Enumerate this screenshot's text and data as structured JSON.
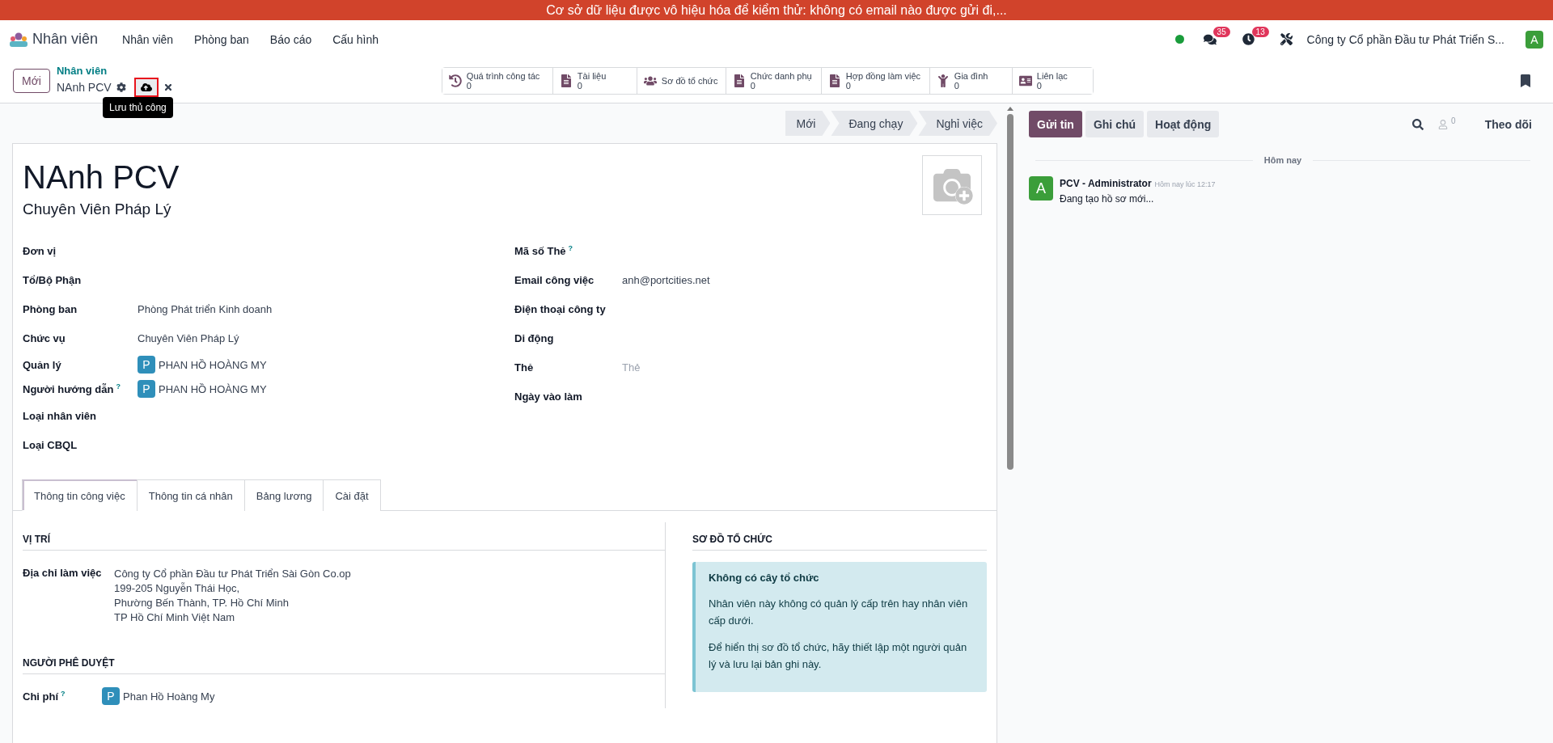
{
  "banner": {
    "text": "Cơ sở dữ liệu được vô hiệu hóa để kiểm thử: không có email nào được gửi đi,..."
  },
  "navbar": {
    "app_name": "Nhân viên",
    "menu": [
      "Nhân viên",
      "Phòng ban",
      "Báo cáo",
      "Cấu hình"
    ],
    "messages_badge": "35",
    "activities_badge": "13",
    "company": "Công ty Cổ phần Đầu tư Phát Triển S...",
    "avatar": "A"
  },
  "control_panel": {
    "new_button": "Mới",
    "breadcrumb": "Nhân viên",
    "record_name": "NAnh PCV",
    "tooltip": "Lưu thủ công",
    "smart_buttons": [
      {
        "label": "Quá trình công tác",
        "count": "0"
      },
      {
        "label": "Tài liệu",
        "count": "0"
      },
      {
        "label": "Sơ đồ tổ chức"
      },
      {
        "label": "Chức danh phụ",
        "count": "0"
      },
      {
        "label": "Hợp đồng làm việc",
        "count": "0"
      },
      {
        "label": "Gia đình",
        "count": "0"
      },
      {
        "label": "Liên lạc",
        "count": "0"
      }
    ]
  },
  "statusbar": [
    {
      "label": "Mới",
      "selected": false
    },
    {
      "label": "Đang chạy",
      "selected": false
    },
    {
      "label": "Nghỉ việc",
      "selected": false
    }
  ],
  "form": {
    "name": "NAnh PCV",
    "job_title": "Chuyên Viên Pháp Lý",
    "left_fields": [
      {
        "label": "Đơn vị",
        "kind": "text"
      },
      {
        "label": "Tổ/Bộ Phận",
        "kind": "text"
      },
      {
        "label": "Phòng ban",
        "kind": "text",
        "value": "Phòng Phát triển Kinh doanh"
      },
      {
        "label": "Chức vụ",
        "kind": "text",
        "value": "Chuyên Viên Pháp Lý"
      },
      {
        "label": "Quản lý",
        "kind": "person",
        "avatar": "P",
        "value": "PHAN HỒ HOÀNG MY"
      },
      {
        "label": "Người hướng dẫn",
        "help": "?",
        "kind": "person",
        "avatar": "P",
        "value": "PHAN HỒ HOÀNG MY"
      },
      {
        "label": "Loại nhân viên",
        "kind": "text"
      },
      {
        "label": "Loại CBQL",
        "kind": "text"
      }
    ],
    "right_fields": [
      {
        "label": "Mã số Thẻ",
        "help": "?",
        "kind": "text"
      },
      {
        "label": "Email công việc",
        "kind": "text",
        "value": "anh@portcities.net"
      },
      {
        "label": "Điện thoại công ty",
        "kind": "text"
      },
      {
        "label": "Di động",
        "kind": "text"
      },
      {
        "label": "Thẻ",
        "kind": "text",
        "placeholder": "Thẻ"
      },
      {
        "label": "Ngày vào làm",
        "kind": "text"
      }
    ]
  },
  "tabs": [
    {
      "label": "Thông tin công việc",
      "selected": true
    },
    {
      "label": "Thông tin cá nhân",
      "selected": false
    },
    {
      "label": "Bảng lương",
      "selected": false
    },
    {
      "label": "Cài đặt",
      "selected": false
    }
  ],
  "position": {
    "title": "VỊ TRÍ",
    "label": "Địa chỉ làm việc",
    "lines": [
      "Công ty Cổ phần Đầu tư Phát Triển Sài Gòn Co.op",
      "199-205 Nguyễn Thái Học,",
      "Phường Bến Thành, TP. Hồ Chí Minh",
      "TP Hồ Chí Minh Việt Nam"
    ]
  },
  "approvers": {
    "title": "NGƯỜI PHÊ DUYỆT",
    "fields": [
      {
        "label": "Chi phí",
        "help": "?",
        "avatar": "P",
        "value": "Phan Hồ Hoàng My"
      }
    ]
  },
  "org_chart": {
    "title": "SƠ ĐỒ TỔ CHỨC",
    "alert_title": "Không có cây tổ chức",
    "paragraphs": [
      "Nhân viên này không có quản lý cấp trên hay nhân viên cấp dưới.",
      "Để hiển thị sơ đồ tổ chức, hãy thiết lập một người quản lý và lưu lại bản ghi này."
    ]
  },
  "chatter": {
    "buttons": [
      {
        "label": "Gửi tin",
        "selected": true
      },
      {
        "label": "Ghi chú",
        "selected": false
      },
      {
        "label": "Hoạt động",
        "selected": false
      }
    ],
    "followers": "0",
    "follow": "Theo dõi",
    "date_separator": "Hôm nay",
    "messages": [
      {
        "avatar": "A",
        "author": "PCV - Administrator",
        "time": "Hôm nay lúc 12:17",
        "body": "Đang tạo hồ sơ mới..."
      }
    ]
  }
}
